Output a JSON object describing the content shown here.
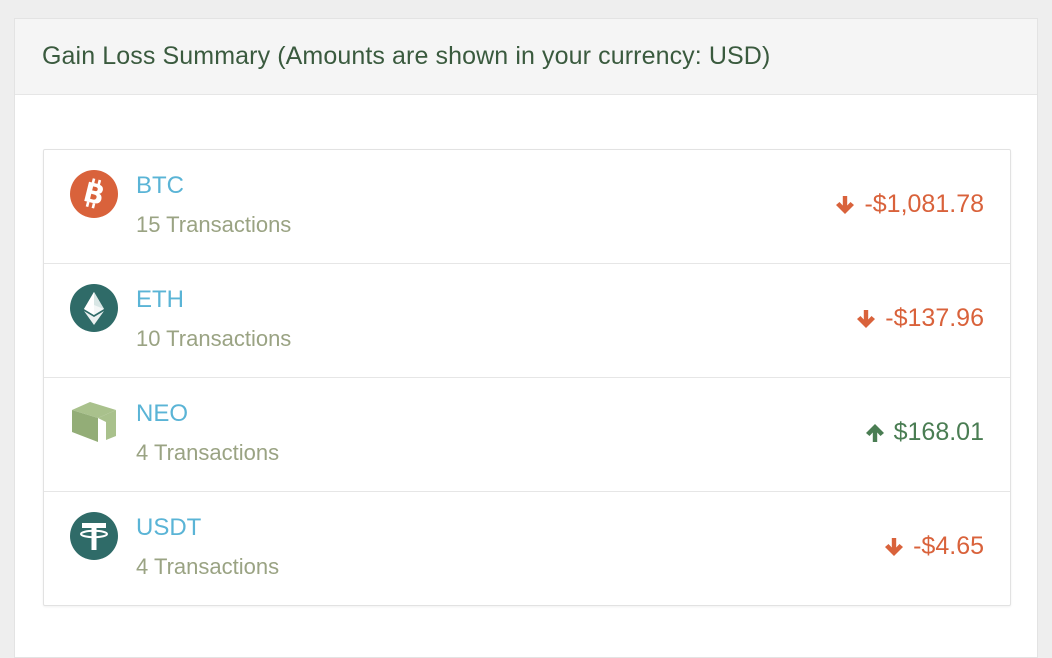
{
  "panel": {
    "title": "Gain Loss Summary (Amounts are shown in your currency: USD)"
  },
  "colors": {
    "loss": "#d9623b",
    "gain": "#4a7d53",
    "link": "#5ab4d6",
    "muted": "#9aa383"
  },
  "coins": [
    {
      "symbol": "BTC",
      "transactions": "15 Transactions",
      "amount": "-$1,081.78",
      "direction": "down",
      "icon": "bitcoin-icon"
    },
    {
      "symbol": "ETH",
      "transactions": "10 Transactions",
      "amount": "-$137.96",
      "direction": "down",
      "icon": "ethereum-icon"
    },
    {
      "symbol": "NEO",
      "transactions": "4 Transactions",
      "amount": "$168.01",
      "direction": "up",
      "icon": "neo-icon"
    },
    {
      "symbol": "USDT",
      "transactions": "4 Transactions",
      "amount": "-$4.65",
      "direction": "down",
      "icon": "tether-icon"
    }
  ]
}
